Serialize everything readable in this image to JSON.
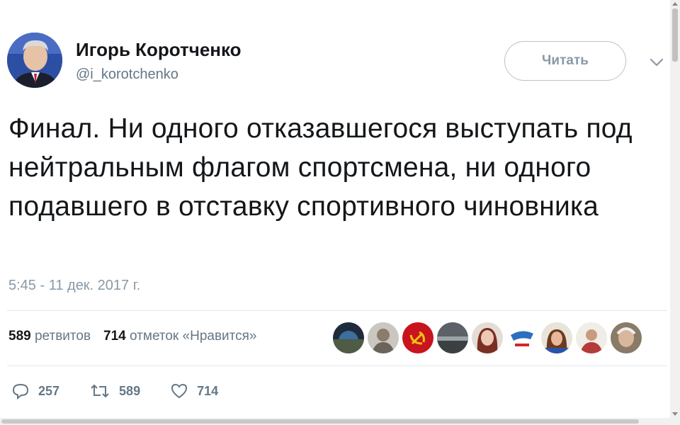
{
  "header": {
    "display_name": "Игорь Коротченко",
    "handle": "@i_korotchenko",
    "follow_label": "Читать"
  },
  "tweet": {
    "text": "Финал. Ни одного отказавшегося выступать под нейтральным флагом спортсмена, ни одного подавшего в отставку спортивного чиновника",
    "timestamp": "5:45 - 11 дек. 2017 г."
  },
  "stats": {
    "retweets_count": "589",
    "retweets_label": "ретвитов",
    "likes_count": "714",
    "likes_label": "отметок «Нравится»"
  },
  "actions": {
    "replies": "257",
    "retweets": "589",
    "likes": "714"
  },
  "colors": {
    "text": "#14171a",
    "secondary": "#657786",
    "divider": "#e1e8ed",
    "button_border": "#b8c2cc"
  },
  "icons": [
    "reply-icon",
    "retweet-icon",
    "heart-icon",
    "chevron-down-icon"
  ]
}
